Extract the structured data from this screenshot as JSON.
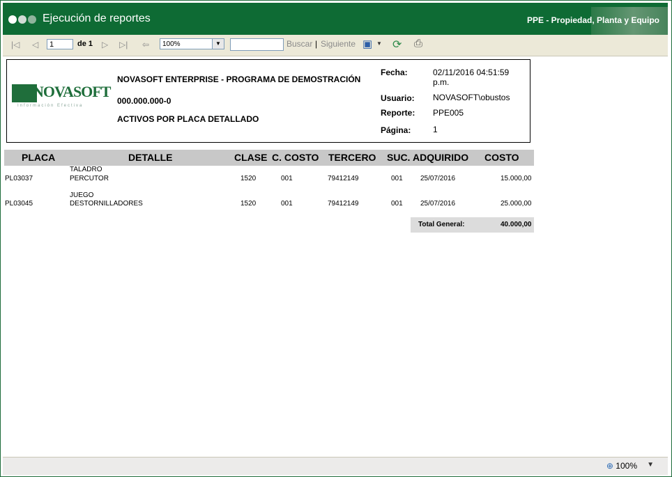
{
  "titlebar": {
    "title": "Ejecución de reportes",
    "module": "PPE - Propiedad, Planta y Equipo"
  },
  "toolbar": {
    "page_value": "1",
    "page_of": "de 1",
    "zoom": "100%",
    "search_value": "",
    "find_label": "Buscar",
    "separator": "|",
    "next_label": "Siguiente"
  },
  "report": {
    "logo": {
      "brand": "NOVASOFT",
      "tagline": "Información Efectiva"
    },
    "company": "NOVASOFT ENTERPRISE - PROGRAMA DE DEMOSTRACIÓN",
    "nit": "000.000.000-0",
    "report_title": "ACTIVOS POR PLACA DETALLADO",
    "meta": {
      "fecha_label": "Fecha:",
      "fecha_value_1": "02/11/2016 04:51:59",
      "fecha_value_2": "p.m.",
      "usuario_label": "Usuario:",
      "usuario_value": "NOVASOFT\\obustos",
      "reporte_label": "Reporte:",
      "reporte_value": "PPE005",
      "pagina_label": "Página:",
      "pagina_value": "1"
    },
    "columns": [
      "PLACA",
      "DETALLE",
      "CLASE",
      "C. COSTO",
      "TERCERO",
      "SUC.",
      "ADQUIRIDO",
      "COSTO"
    ],
    "rows": [
      {
        "placa": "PL03037",
        "detalle_1": "TALADRO",
        "detalle_2": "PERCUTOR",
        "clase": "1520",
        "ccosto": "001",
        "tercero": "79412149",
        "suc": "001",
        "adquirido": "25/07/2016",
        "costo": "15.000,00"
      },
      {
        "placa": "PL03045",
        "detalle_1": "JUEGO",
        "detalle_2": "DESTORNILLADORES",
        "clase": "1520",
        "ccosto": "001",
        "tercero": "79412149",
        "suc": "001",
        "adquirido": "25/07/2016",
        "costo": "25.000,00"
      }
    ],
    "total_label": "Total General:",
    "total_value": "40.000,00"
  },
  "statusbar": {
    "zoom": "100%"
  },
  "icons": [
    "first-page-icon",
    "previous-page-icon",
    "next-page-icon",
    "last-page-icon",
    "back-icon",
    "export-icon",
    "refresh-icon",
    "print-icon",
    "zoom-magnifier-icon",
    "dropdown-arrow-icon"
  ],
  "colors": {
    "titlebar": "#0e6b34",
    "toolbar": "#ece9d8",
    "column_header": "#c8c8c8",
    "total_bg": "#dcdcdc"
  }
}
